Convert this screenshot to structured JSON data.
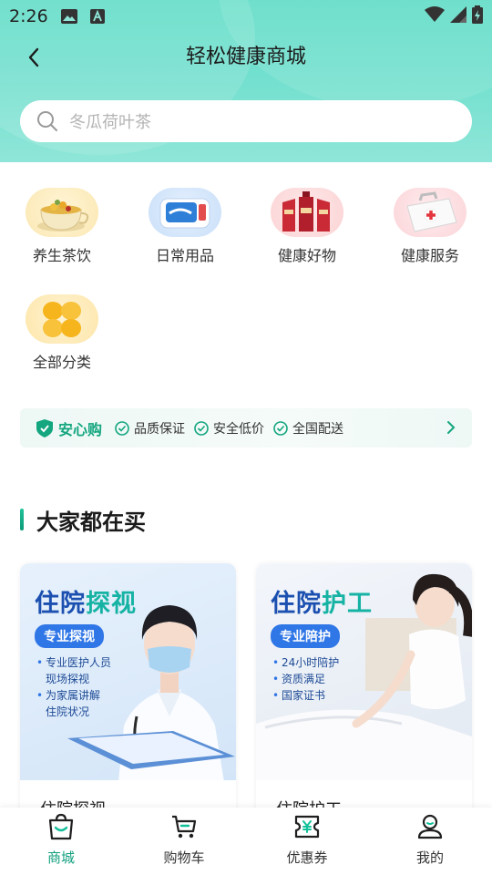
{
  "status_bar": {
    "time": "2:26"
  },
  "header": {
    "title": "轻松健康商城"
  },
  "search": {
    "placeholder": "冬瓜荷叶茶"
  },
  "categories": [
    {
      "label": "养生茶饮"
    },
    {
      "label": "日常用品"
    },
    {
      "label": "健康好物"
    },
    {
      "label": "健康服务"
    },
    {
      "label": "全部分类"
    }
  ],
  "assurance_banner": {
    "brand": "安心购",
    "items": [
      "品质保证",
      "安全低价",
      "全国配送"
    ]
  },
  "section": {
    "title": "大家都在买"
  },
  "products": [
    {
      "title_a": "住院",
      "title_b": "探视",
      "tag": "专业探视",
      "lines": [
        "专业医护人员",
        "现场探视",
        "为家属讲解",
        "住院状况"
      ],
      "name": "住院探视"
    },
    {
      "title_a": "住院",
      "title_b": "护工",
      "tag": "专业陪护",
      "lines": [
        "24小时陪护",
        "资质满足",
        "国家证书"
      ],
      "name": "住院护工"
    }
  ],
  "tabbar": [
    {
      "label": "商城",
      "icon": "shopping-bag-icon",
      "active": true
    },
    {
      "label": "购物车",
      "icon": "cart-icon"
    },
    {
      "label": "优惠券",
      "icon": "coupon-icon"
    },
    {
      "label": "我的",
      "icon": "user-icon"
    }
  ],
  "colors": {
    "accent": "#12a07f",
    "header": "#6fdfcb",
    "brand_blue": "#2f76e6"
  }
}
